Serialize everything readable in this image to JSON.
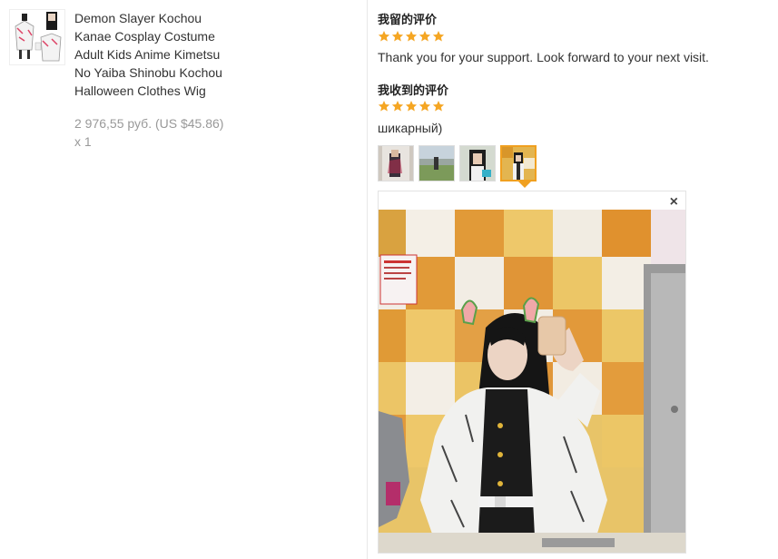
{
  "product": {
    "title": "Demon Slayer Kochou Kanae Cosplay Costume Adult Kids Anime Kimetsu No Yaiba Shinobu Kochou Halloween Clothes Wig",
    "price": "2 976,55 руб. (US $45.86)",
    "quantity": "x 1",
    "thumbnail_icon": "costume-product-image"
  },
  "my_review": {
    "title": "我留的评价",
    "rating": 5,
    "text": "Thank you for your support. Look forward to your next visit."
  },
  "received_review": {
    "title": "我收到的评价",
    "rating": 5,
    "text": "шикарный)",
    "photos": [
      "review-photo-1",
      "review-photo-2",
      "review-photo-3",
      "review-photo-4"
    ],
    "active_photo": 3
  },
  "viewer": {
    "close_label": "×",
    "photo_icon": "cosplay-mirror-selfie-photo"
  },
  "colors": {
    "star": "#f5a623",
    "active_border": "#f0a020",
    "muted_text": "#999999"
  }
}
